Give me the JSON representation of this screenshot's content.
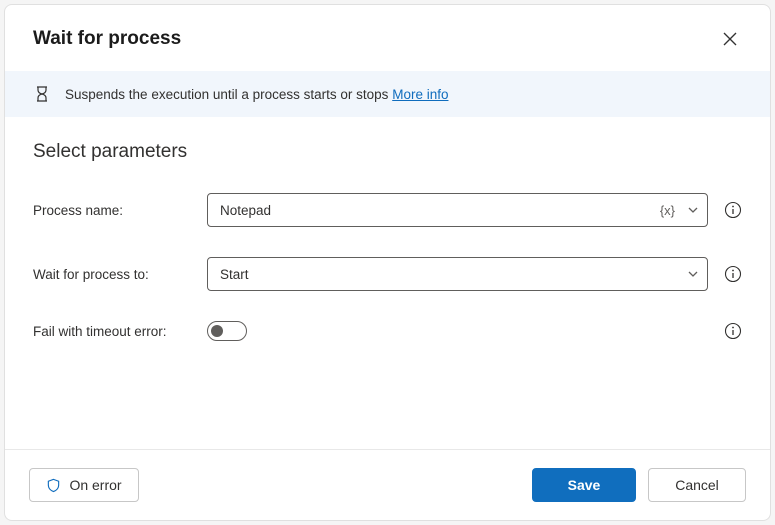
{
  "header": {
    "title": "Wait for process"
  },
  "banner": {
    "text": "Suspends the execution until a process starts or stops",
    "link_text": "More info"
  },
  "section": {
    "title": "Select parameters"
  },
  "fields": {
    "process_name": {
      "label": "Process name:",
      "value": "Notepad",
      "var_symbol": "{x}"
    },
    "wait_for": {
      "label": "Wait for process to:",
      "value": "Start"
    },
    "fail_timeout": {
      "label": "Fail with timeout error:",
      "value": false
    }
  },
  "footer": {
    "on_error": "On error",
    "save": "Save",
    "cancel": "Cancel"
  }
}
